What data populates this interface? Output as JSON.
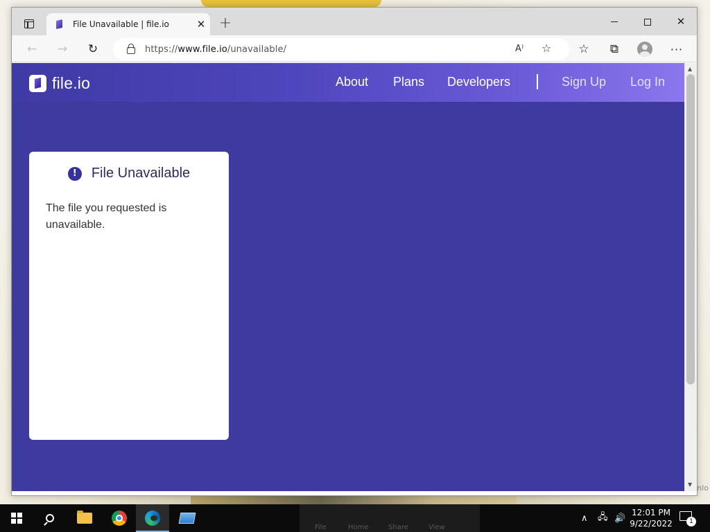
{
  "browser": {
    "tab": {
      "title": "File Unavailable | file.io",
      "favicon": "file-io-favicon-icon",
      "close_glyph": "✕"
    },
    "new_tab_glyph": "+",
    "address": {
      "url_scheme": "https://",
      "url_host": "www.file.io",
      "url_path": "/unavailable/"
    },
    "toolbar": {
      "back_glyph": "←",
      "forward_glyph": "→",
      "reload_glyph": "↻",
      "read_aloud_glyph": "A⁾",
      "favorite_glyph": "☆",
      "favorites_glyph": "☆",
      "collections_glyph": "⧉",
      "more_glyph": "···"
    },
    "window_controls": {
      "close_glyph": "✕"
    }
  },
  "site": {
    "logo_text": "file.io",
    "nav": {
      "about": "About",
      "plans": "Plans",
      "developers": "Developers",
      "sign_up": "Sign Up",
      "log_in": "Log In"
    },
    "colors": {
      "background": "#3f3a9d",
      "header_start": "#3f3aa5",
      "header_end": "#8b77ee",
      "accent": "#35339a"
    }
  },
  "card": {
    "icon": "alert-circle-icon",
    "icon_glyph": "!",
    "title": "File Unavailable",
    "message": "The file you requested is unavailable."
  },
  "taskbar": {
    "apps": [
      "start-icon",
      "search-icon",
      "file-explorer-icon",
      "chrome-icon",
      "edge-icon",
      "app-icon"
    ],
    "ghost_menu": {
      "file": "File",
      "home": "Home",
      "share": "Share",
      "view": "View"
    },
    "tray": {
      "chevron_glyph": "∧",
      "network_glyph": "🖧",
      "volume_glyph": "🔊"
    },
    "clock": {
      "time": "12:01 PM",
      "date": "9/22/2022"
    },
    "notification_count": "1"
  },
  "desktop": {
    "ghost_text": "nlo"
  }
}
